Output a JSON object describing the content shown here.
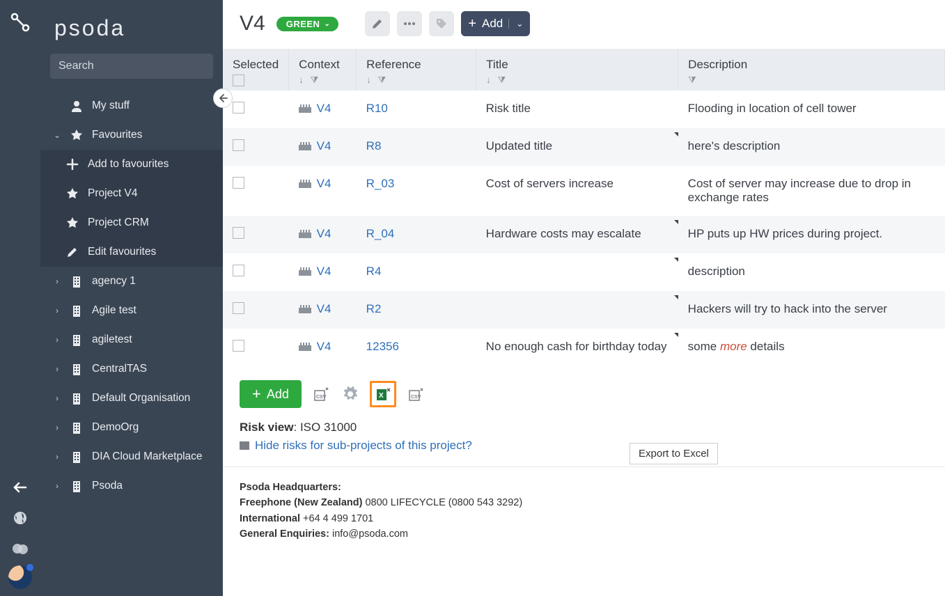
{
  "brand": "psoda",
  "search": {
    "placeholder": "Search"
  },
  "sidebar": {
    "my_stuff": "My stuff",
    "favourites": "Favourites",
    "fav_items": {
      "add": "Add to favourites",
      "v4": "Project V4",
      "crm": "Project CRM",
      "edit": "Edit favourites"
    },
    "orgs": [
      "agency 1",
      "Agile test",
      "agiletest",
      "CentralTAS",
      "Default Organisation",
      "DemoOrg",
      "DIA Cloud Marketplace",
      "Psoda"
    ]
  },
  "topbar": {
    "title": "V4",
    "status": "GREEN",
    "add": "Add"
  },
  "table": {
    "headers": {
      "selected": "Selected",
      "context": "Context",
      "reference": "Reference",
      "title": "Title",
      "description": "Description"
    },
    "rows": [
      {
        "ctx": "V4",
        "ref": "R10",
        "title": "Risk title",
        "desc": "Flooding in location of cell tower",
        "tri": false
      },
      {
        "ctx": "V4",
        "ref": "R8",
        "title": "Updated title",
        "desc": "here's description",
        "tri": true
      },
      {
        "ctx": "V4",
        "ref": "R_03",
        "title": "Cost of servers increase",
        "desc": "Cost of server may increase due to drop in exchange rates",
        "tri": false
      },
      {
        "ctx": "V4",
        "ref": "R_04",
        "title": "Hardware costs may escalate",
        "desc": "HP puts up HW prices during project.",
        "tri": true
      },
      {
        "ctx": "V4",
        "ref": "R4",
        "title": "",
        "desc": "description",
        "tri": true
      },
      {
        "ctx": "V4",
        "ref": "R2",
        "title": "",
        "desc": "Hackers will try to hack into the server",
        "tri": true
      },
      {
        "ctx": "V4",
        "ref": "12356",
        "title": "No enough cash for birthday today",
        "desc": "some ",
        "desc_more": "more",
        "desc_tail": " details",
        "tri": true
      }
    ]
  },
  "bottom": {
    "add": "Add",
    "tooltip": "Export to Excel"
  },
  "risk_info": {
    "label": "Risk view",
    "value": "ISO 31000",
    "sublink": "Hide risks for sub-projects of this project?"
  },
  "footer": {
    "hq": "Psoda Headquarters:",
    "nz_label": "Freephone (New Zealand)",
    "nz_value": " 0800 LIFECYCLE (0800 543 3292)",
    "intl_label": "International",
    "intl_value": " +64 4 499 1701",
    "enq_label": "General Enquiries:",
    "enq_value": " info@psoda.com"
  }
}
